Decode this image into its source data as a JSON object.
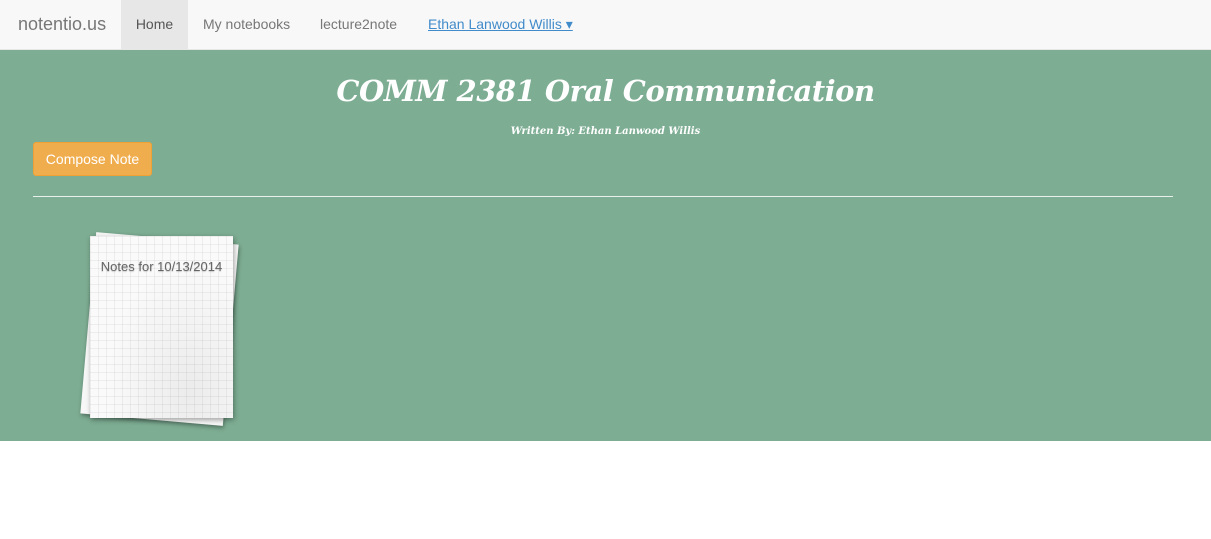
{
  "navbar": {
    "brand": "notentio.us",
    "items": [
      {
        "label": "Home",
        "active": true
      },
      {
        "label": "My notebooks"
      },
      {
        "label": "lecture2note"
      },
      {
        "label": "Ethan Lanwood Willis ▾"
      }
    ]
  },
  "notebook": {
    "title": "COMM 2381 Oral Communication",
    "author_line": "Written By: Ethan Lanwood Willis",
    "compose_label": "Compose Note",
    "notes": [
      {
        "title": "Notes for 10/13/2014"
      }
    ]
  },
  "colors": {
    "background_green": "#7dad93",
    "compose_button": "#f0ad4e",
    "user_link": "#428bca"
  }
}
